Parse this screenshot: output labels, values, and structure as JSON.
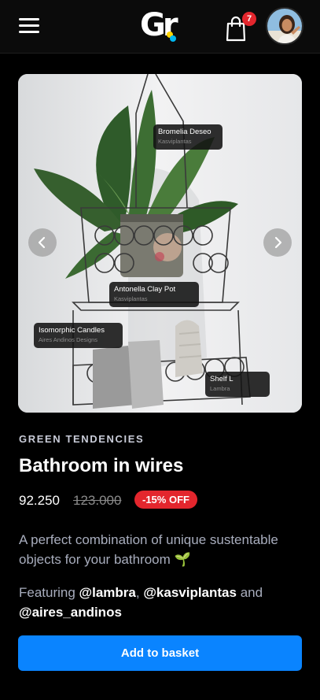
{
  "header": {
    "logo_text": "Gr",
    "cart_count": "7",
    "menu_icon": "hamburger-menu-icon",
    "cart_icon": "shopping-bag-icon",
    "avatar": "user-avatar"
  },
  "product": {
    "category": "GREEN TENDENCIES",
    "title": "Bathroom in wires",
    "price": "92.250",
    "old_price": "123.000",
    "discount": "-15% OFF",
    "description": "A perfect combination of unique sustentable objects for your bathroom 🌱",
    "featuring_prefix": "Featuring ",
    "brand_1": "@lambra",
    "sep_1": ", ",
    "brand_2": "@kasviplantas",
    "sep_2": " and ",
    "brand_3": "@aires_andinos",
    "add_label": "Add to basket"
  },
  "tags": [
    {
      "title": "Bromelia Deseo",
      "brand": "Kasviplantas"
    },
    {
      "title": "Antonella Clay Pot",
      "brand": "Kasviplantas"
    },
    {
      "title": "Isomorphic Candles",
      "brand": "Aires Andinos Designs"
    },
    {
      "title": "Shelf L",
      "brand": "Lambra"
    }
  ],
  "colors": {
    "accent": "#0a84ff",
    "discount": "#e3262d",
    "badge": "#e3262d"
  }
}
